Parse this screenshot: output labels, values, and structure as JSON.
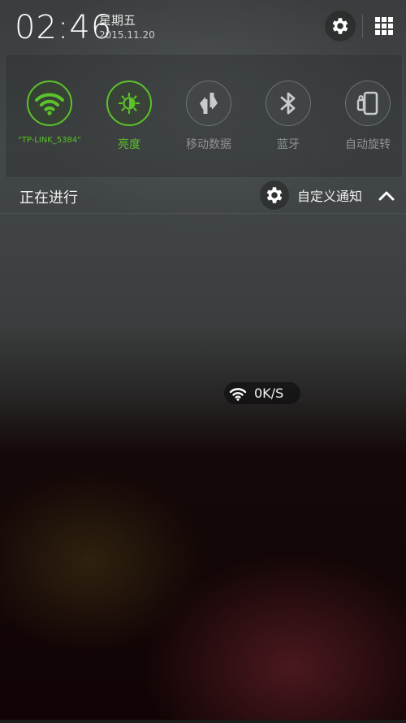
{
  "status_bar": {
    "time": "02:46",
    "weekday": "星期五",
    "date": "2015.11.20",
    "settings_icon": "gear-icon",
    "apps_icon": "grid-icon"
  },
  "quick_toggles": [
    {
      "label": "\"TP-LINK_5384\"",
      "icon": "wifi-icon",
      "active": true
    },
    {
      "label": "亮度",
      "icon": "brightness-icon",
      "active": true
    },
    {
      "label": "移动数据",
      "icon": "mobile-data-icon",
      "active": false
    },
    {
      "label": "蓝牙",
      "icon": "bluetooth-icon",
      "active": false
    },
    {
      "label": "自动旋转",
      "icon": "auto-rotate-icon",
      "active": false
    }
  ],
  "ongoing": {
    "title": "正在进行",
    "custom_notify_label": "自定义通知",
    "collapse_icon": "chevron-up-icon"
  },
  "network_speed": {
    "value": "0K/S",
    "icon": "wifi-icon"
  },
  "colors": {
    "accent_green": "#5cc22b",
    "inactive_text": "#8e9292"
  }
}
